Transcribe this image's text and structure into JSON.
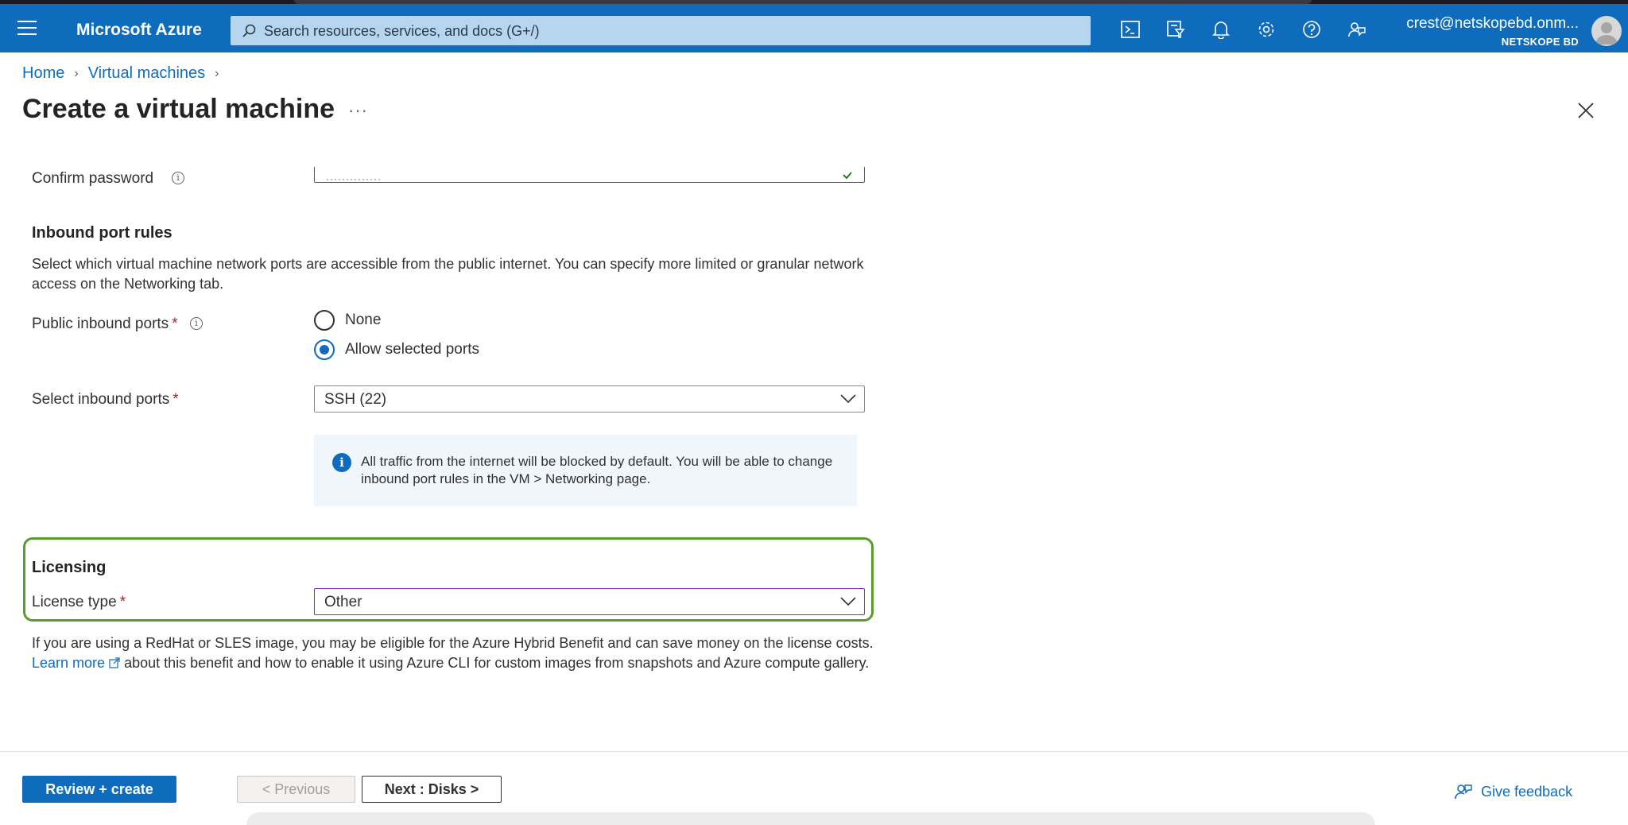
{
  "header": {
    "brand": "Microsoft Azure",
    "search_placeholder": "Search resources, services, and docs (G+/)",
    "user_email": "crest@netskopebd.onm...",
    "user_org": "NETSKOPE BD",
    "icons": [
      "cloud-shell-icon",
      "directory-filter-icon",
      "bell-icon",
      "gear-icon",
      "help-icon",
      "feedback-icon"
    ]
  },
  "breadcrumb": {
    "home": "Home",
    "virtual_machines": "Virtual machines"
  },
  "page": {
    "title": "Create a virtual machine",
    "more": "···"
  },
  "confirm_password": {
    "label": "Confirm password",
    "value": "··············"
  },
  "inbound": {
    "title": "Inbound port rules",
    "description": "Select which virtual machine network ports are accessible from the public internet. You can specify more limited or granular network access on the Networking tab.",
    "public_ports_label": "Public inbound ports",
    "radio_none": "None",
    "radio_allow": "Allow selected ports",
    "select_ports_label": "Select inbound ports",
    "select_ports_value": "SSH (22)",
    "info_message": "All traffic from the internet will be blocked by default. You will be able to change inbound port rules in the VM > Networking page."
  },
  "licensing": {
    "title": "Licensing",
    "license_type_label": "License type",
    "license_type_value": "Other",
    "note_part1": "If you are using a RedHat or SLES image, you may be eligible for the Azure Hybrid Benefit and can save money on the license costs.",
    "learn_more": "Learn more",
    "note_part2": "about this benefit and how to enable it using Azure CLI for custom images from snapshots and Azure compute gallery."
  },
  "footer": {
    "review_create": "Review + create",
    "previous": "< Previous",
    "next": "Next : Disks >",
    "give_feedback": "Give feedback"
  },
  "colors": {
    "azure_blue": "#0f6cbd",
    "highlight_green": "#5a9b2e",
    "focus_purple": "#8a2bb8",
    "required_red": "#a4262c"
  }
}
